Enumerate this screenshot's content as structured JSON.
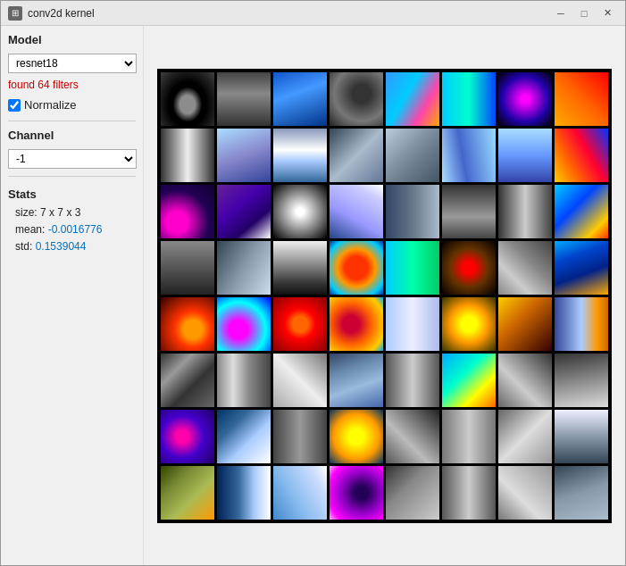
{
  "window": {
    "title": "conv2d kernel",
    "icon": "⊞"
  },
  "titlebar": {
    "minimize_label": "─",
    "maximize_label": "□",
    "close_label": "✕"
  },
  "sidebar": {
    "model_label": "Model",
    "model_value": "resnet18",
    "found_filters": "found 64 filters",
    "normalize_label": "Normalize",
    "normalize_checked": true,
    "channel_label": "Channel",
    "channel_value": "-1",
    "stats_label": "Stats",
    "stats": {
      "size_label": "size:",
      "size_value": "7 x 7 x 3",
      "mean_label": "mean:",
      "mean_value": "-0.0016776",
      "std_label": "std:",
      "std_value": "0.1539044"
    }
  },
  "filters": {
    "count": 64,
    "grid_cols": 8,
    "grid_rows": 8
  }
}
